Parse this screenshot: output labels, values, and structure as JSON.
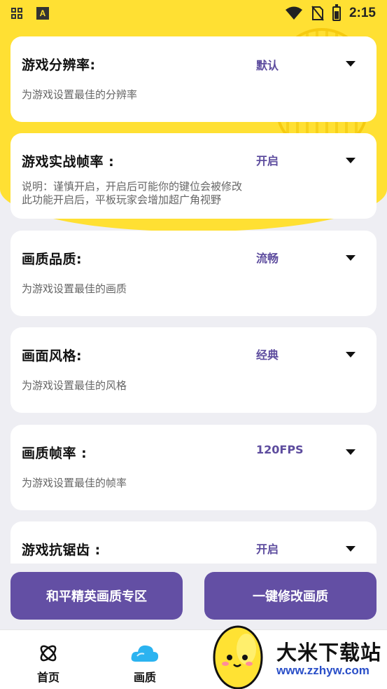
{
  "status_bar": {
    "time": "2:15"
  },
  "settings": [
    {
      "title": "游戏分辨率:",
      "value": "默认",
      "description": [
        "为游戏设置最佳的分辨率"
      ]
    },
    {
      "title": "游戏实战帧率 :",
      "value": "开启",
      "description": [
        "说明：谨慎开启，开启后可能你的键位会被修改",
        "此功能开启后，平板玩家会增加超广角视野"
      ]
    },
    {
      "title": "画质品质:",
      "value": "流畅",
      "description": [
        "为游戏设置最佳的画质"
      ]
    },
    {
      "title": "画面风格:",
      "value": "经典",
      "description": [
        "为游戏设置最佳的风格"
      ]
    },
    {
      "title": "画质帧率 :",
      "value": "120FPS",
      "description": [
        "为游戏设置最佳的帧率"
      ]
    },
    {
      "title": "游戏抗锯齿 :",
      "value": "开启",
      "description": []
    }
  ],
  "buttons": {
    "left_label": "和平精英画质专区",
    "right_label": "一键修改画质"
  },
  "tabbar": {
    "home_label": "首页",
    "quality_label": "画质"
  },
  "watermark": {
    "name": "大米下载站",
    "url": "www.zzhyw.com"
  },
  "colors": {
    "accent": "#634fa4",
    "value_text": "#5d4c9e",
    "hero": "#ffe033",
    "background": "#eeeef3"
  },
  "icons": [
    "grid-icon",
    "app-a-icon",
    "wifi-icon",
    "no-sim-icon",
    "battery-charging-icon",
    "dropdown-caret-icon",
    "orbit-icon",
    "cloud-icon",
    "mascot-icon"
  ]
}
